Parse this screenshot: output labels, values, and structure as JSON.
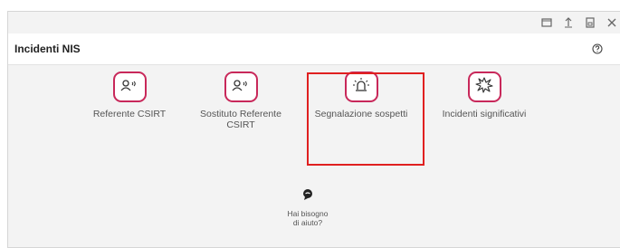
{
  "window": {
    "controls": [
      {
        "name": "restore-icon"
      },
      {
        "name": "upload-icon"
      },
      {
        "name": "save-icon"
      },
      {
        "name": "close-icon"
      }
    ]
  },
  "header": {
    "title": "Incidenti NIS",
    "help_icon": "question-circle-icon"
  },
  "tiles": [
    {
      "label": "Referente CSIRT",
      "icon": "user-signal-icon"
    },
    {
      "label": "Sostituto Referente CSIRT",
      "icon": "user-signal-icon"
    },
    {
      "label": "Segnalazione sospetti",
      "icon": "alarm-siren-icon",
      "highlighted": true
    },
    {
      "label": "Incidenti significativi",
      "icon": "explosion-icon"
    }
  ],
  "help": {
    "line1": "Hai bisogno",
    "line2": "di aiuto?",
    "icon": "chat-bubble-icon"
  },
  "colors": {
    "accent": "#c8285a",
    "highlight": "#e02020",
    "background": "#f3f3f3"
  }
}
